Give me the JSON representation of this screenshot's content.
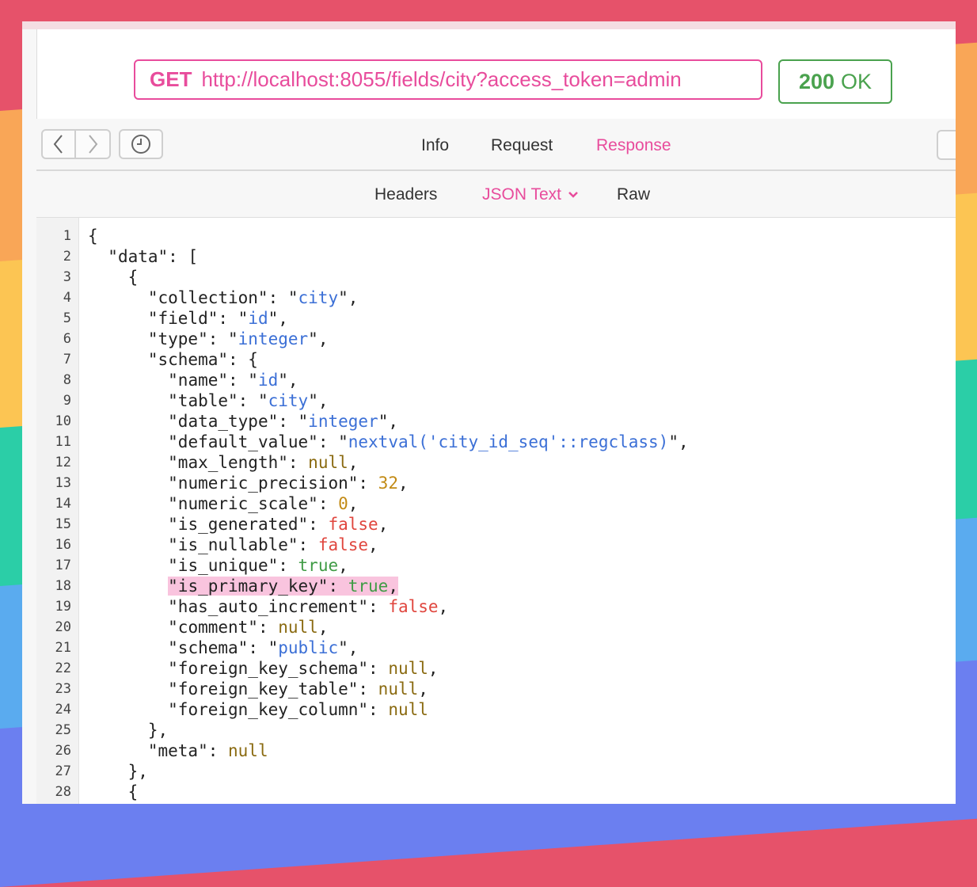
{
  "request": {
    "method": "GET",
    "url": "http://localhost:8055/fields/city?access_token=admin"
  },
  "status": {
    "code": "200",
    "text": "OK"
  },
  "tabs": [
    {
      "label": "Info"
    },
    {
      "label": "Request"
    },
    {
      "label": "Response"
    }
  ],
  "subtabs": [
    {
      "label": "Headers"
    },
    {
      "label": "JSON Text"
    },
    {
      "label": "Raw"
    }
  ],
  "icons": {
    "back": "chevron-left-icon",
    "forward": "chevron-right-icon",
    "history": "clock-icon",
    "dropdown": "chevron-down-icon"
  },
  "colors": {
    "accent": "#e84c9c",
    "success": "#4aa24e",
    "string": "#3b6fd6",
    "number": "#c28a14",
    "false": "#e0463e",
    "true": "#3f9b45"
  },
  "code_lines": [
    {
      "n": "1",
      "text": "{"
    },
    {
      "n": "2",
      "text": "  \"data\": ["
    },
    {
      "n": "3",
      "text": "    {"
    },
    {
      "n": "4",
      "text": "      \"collection\": \"city\","
    },
    {
      "n": "5",
      "text": "      \"field\": \"id\","
    },
    {
      "n": "6",
      "text": "      \"type\": \"integer\","
    },
    {
      "n": "7",
      "text": "      \"schema\": {"
    },
    {
      "n": "8",
      "text": "        \"name\": \"id\","
    },
    {
      "n": "9",
      "text": "        \"table\": \"city\","
    },
    {
      "n": "10",
      "text": "        \"data_type\": \"integer\","
    },
    {
      "n": "11",
      "text": "        \"default_value\": \"nextval('city_id_seq'::regclass)\","
    },
    {
      "n": "12",
      "text": "        \"max_length\": null,"
    },
    {
      "n": "13",
      "text": "        \"numeric_precision\": 32,"
    },
    {
      "n": "14",
      "text": "        \"numeric_scale\": 0,"
    },
    {
      "n": "15",
      "text": "        \"is_generated\": false,"
    },
    {
      "n": "16",
      "text": "        \"is_nullable\": false,"
    },
    {
      "n": "17",
      "text": "        \"is_unique\": true,"
    },
    {
      "n": "18",
      "text": "        \"is_primary_key\": true,",
      "highlight": true
    },
    {
      "n": "19",
      "text": "        \"has_auto_increment\": false,"
    },
    {
      "n": "20",
      "text": "        \"comment\": null,"
    },
    {
      "n": "21",
      "text": "        \"schema\": \"public\","
    },
    {
      "n": "22",
      "text": "        \"foreign_key_schema\": null,"
    },
    {
      "n": "23",
      "text": "        \"foreign_key_table\": null,"
    },
    {
      "n": "24",
      "text": "        \"foreign_key_column\": null"
    },
    {
      "n": "25",
      "text": "      },"
    },
    {
      "n": "26",
      "text": "      \"meta\": null"
    },
    {
      "n": "27",
      "text": "    },"
    },
    {
      "n": "28",
      "text": "    {"
    }
  ]
}
